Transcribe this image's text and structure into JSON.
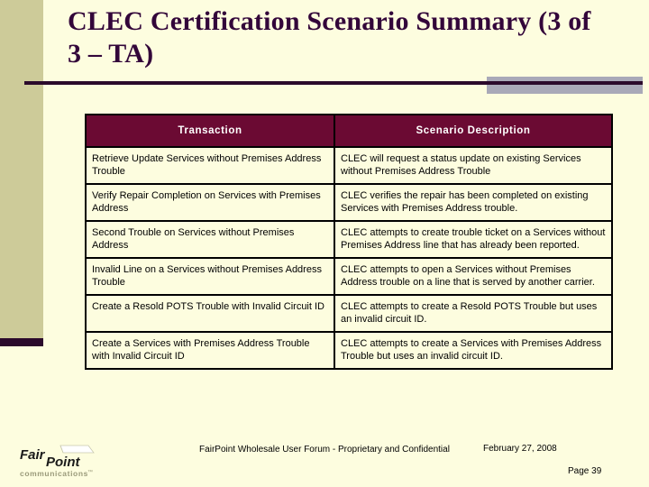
{
  "slide": {
    "title": "CLEC Certification Scenario Summary (3 of 3 – TA)",
    "accent_purple": "#2b0a2b",
    "accent_maroon": "#6b0a33",
    "band_olive": "#cdcb99",
    "band_gray": "#a9a9b8",
    "background": "#fdfddf"
  },
  "table": {
    "headers": {
      "transaction": "Transaction",
      "description": "Scenario Description"
    },
    "rows": [
      {
        "transaction": "Retrieve Update Services without Premises Address Trouble",
        "description": "CLEC will request a status update on existing Services without Premises Address Trouble"
      },
      {
        "transaction": "Verify Repair Completion on Services with Premises Address",
        "description": "CLEC verifies the repair has been completed on existing Services with Premises Address trouble."
      },
      {
        "transaction": "Second Trouble on Services without Premises Address",
        "description": "CLEC attempts to create trouble ticket on a Services without Premises Address line that has already been reported."
      },
      {
        "transaction": "Invalid Line on a Services without Premises Address Trouble",
        "description": "CLEC attempts to open a Services without Premises Address trouble on a line that is served by another carrier."
      },
      {
        "transaction": "Create a Resold POTS Trouble with Invalid Circuit ID",
        "description": "CLEC attempts to create a Resold POTS Trouble but uses an invalid circuit ID."
      },
      {
        "transaction": "Create a Services with Premises Address Trouble with Invalid Circuit ID",
        "description": "CLEC attempts to create a Services with Premises Address Trouble but uses an invalid circuit ID."
      }
    ]
  },
  "footer": {
    "confidentiality": "FairPoint Wholesale User Forum - Proprietary and Confidential",
    "date": "February 27, 2008",
    "page": "Page 39"
  },
  "logo": {
    "word_one": "Fair",
    "word_two": "Point",
    "tagline": "communications",
    "trademark": "™"
  }
}
